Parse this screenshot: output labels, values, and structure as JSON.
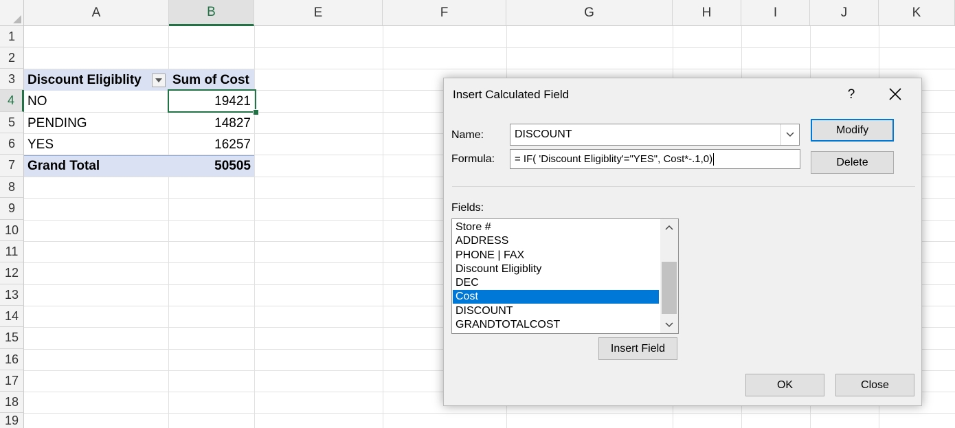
{
  "spreadsheet": {
    "columns": [
      "A",
      "B",
      "E",
      "F",
      "G",
      "H",
      "I",
      "J",
      "K"
    ],
    "rows": [
      "1",
      "2",
      "3",
      "4",
      "5",
      "6",
      "7",
      "8",
      "9",
      "10",
      "11",
      "12",
      "13",
      "14",
      "15",
      "16",
      "17",
      "18",
      "19"
    ],
    "pivot": {
      "header_row_label": "Discount Eligiblity",
      "header_value_label": "Sum of Cost",
      "rows": [
        {
          "label": "NO",
          "value": "19421"
        },
        {
          "label": "PENDING",
          "value": "14827"
        },
        {
          "label": "YES",
          "value": "16257"
        }
      ],
      "total_label": "Grand Total",
      "total_value": "50505"
    },
    "accent_color": "#217346",
    "pivot_header_color": "#d9e1f2"
  },
  "dialog": {
    "title": "Insert Calculated Field",
    "help_label": "?",
    "name_label": "Name:",
    "name_value": "DISCOUNT",
    "formula_label": "Formula:",
    "formula_value": "= IF( 'Discount Eligiblity'=\"YES\", Cost*-.1,0)",
    "modify_label": "Modify",
    "delete_label": "Delete",
    "fields_label": "Fields:",
    "fields": [
      "Store #",
      "ADDRESS",
      "PHONE | FAX",
      "Discount Eligiblity",
      "DEC",
      "Cost",
      "DISCOUNT",
      "GRANDTOTALCOST"
    ],
    "selected_field": "Cost",
    "insert_field_label": "Insert Field",
    "ok_label": "OK",
    "close_label": "Close",
    "selection_color": "#0078d7"
  }
}
